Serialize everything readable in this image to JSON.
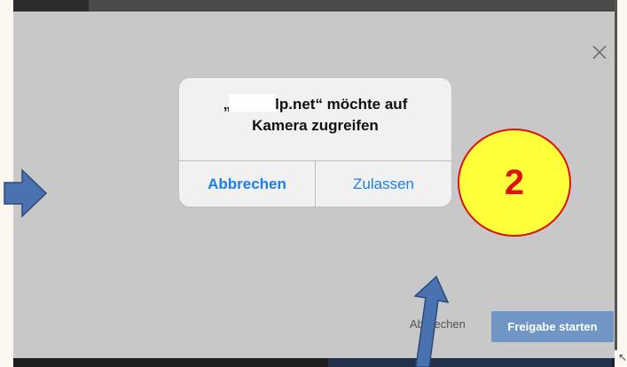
{
  "background": {
    "overlay_color": "#c8c8c8",
    "accent_blue": "#1a7ff0",
    "primary_button_color": "#6f96c4"
  },
  "close": {
    "icon": "close-icon"
  },
  "dialog": {
    "message_line1_prefix": "„",
    "message_line1_suffix": "lp.net“ möchte auf",
    "message_line2": "Kamera zugreifen",
    "cancel_label": "Abbrechen",
    "allow_label": "Zulassen"
  },
  "annotation": {
    "step_number": "2",
    "badge_fill": "#ffff3a",
    "badge_stroke": "#e01010",
    "arrow_color": "#4a72b0"
  },
  "footer": {
    "cancel_label": "Abbrechen",
    "start_label": "Freigabe starten"
  },
  "corner_glyph": "↖"
}
